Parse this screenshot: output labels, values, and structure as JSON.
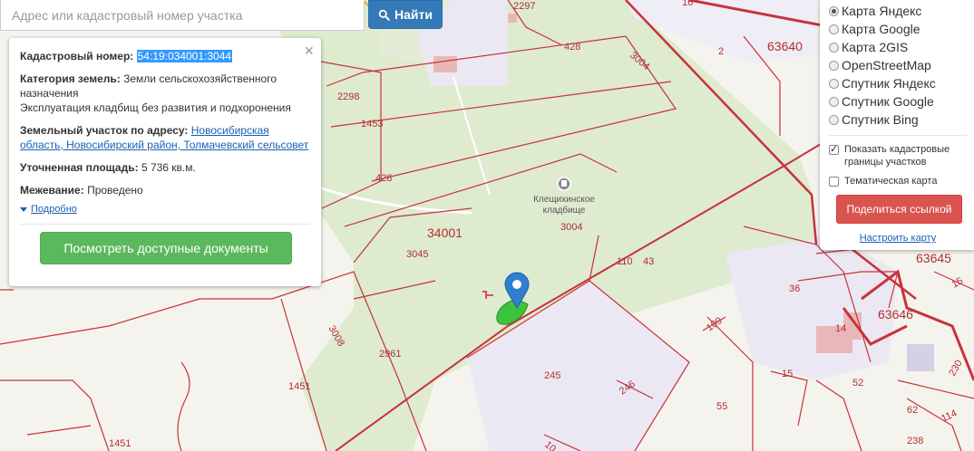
{
  "search": {
    "placeholder": "Адрес или кадастровый номер участка",
    "button_label": "Найти"
  },
  "info": {
    "cadastral_label": "Кадастровый номер:",
    "cadastral_value": "54:19:034001:3044",
    "category_label": "Категория земель:",
    "category_value": "Земли сельскохозяйственного назначения",
    "usage": "Эксплуатация кладбищ без развития и подхоронения",
    "address_label": "Земельный участок по адресу:",
    "address_value": "Новосибирская область, Новосибирский район, Толмачевский сельсовет",
    "area_label": "Уточненная площадь:",
    "area_value": "5 736 кв.м.",
    "survey_label": "Межевание:",
    "survey_value": "Проведено",
    "more_label": "Подробно",
    "close_symbol": "×",
    "docs_button": "Посмотреть доступные документы"
  },
  "layers": {
    "options": [
      {
        "label": "Карта Яндекс",
        "selected": true
      },
      {
        "label": "Карта Google",
        "selected": false
      },
      {
        "label": "Карта 2GIS",
        "selected": false
      },
      {
        "label": "OpenStreetMap",
        "selected": false
      },
      {
        "label": "Спутник Яндекс",
        "selected": false
      },
      {
        "label": "Спутник Google",
        "selected": false
      },
      {
        "label": "Спутник Bing",
        "selected": false
      }
    ],
    "show_borders_label": "Показать кадастровые границы участков",
    "show_borders_checked": true,
    "thematic_label": "Тематическая карта",
    "thematic_checked": false,
    "share_button": "Поделиться ссылкой",
    "configure_link": "Настроить карту"
  },
  "map": {
    "poi_name_line1": "Клещихинское",
    "poi_name_line2": "кладбище",
    "labels": {
      "l2297": "2297",
      "l16": "16",
      "l428a": "428",
      "l3004a": "3004",
      "l2": "2",
      "l63640": "63640",
      "l2298": "2298",
      "l1453": "1453",
      "l428b": "428",
      "l34001": "34001",
      "l3004b": "3004",
      "l3045": "3045",
      "l110": "110",
      "l43": "43",
      "l63645": "63645",
      "l15a": "15",
      "l36": "36",
      "l109": "109",
      "l14": "14",
      "l63646": "63646",
      "l3008": "3008",
      "l2961": "2961",
      "l245": "245",
      "l246": "246",
      "l1451a": "1451",
      "l1451b": "1451",
      "l55": "55",
      "l15b": "15",
      "l52": "52",
      "l62": "62",
      "l114": "114",
      "l230": "230",
      "l10": "10",
      "l238": "238"
    },
    "colors": {
      "cadastre_line": "#c8323c",
      "field_green": "#deebcf",
      "industrial_lilac": "#ebe8f3",
      "marker_blue": "#2f7fd0",
      "parcel_green": "#3cc23c"
    }
  }
}
